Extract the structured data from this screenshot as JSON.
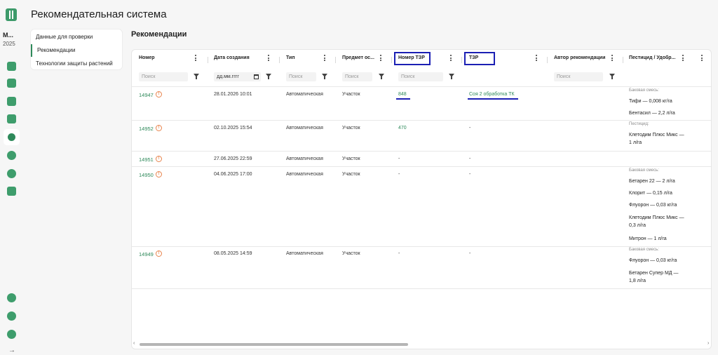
{
  "app": {
    "title": "Рекомендательная система"
  },
  "org": {
    "name": "М...",
    "year": "2025"
  },
  "rail_icons": [
    "fields-icon",
    "layers-icon",
    "machinery-icon",
    "clipboard-icon",
    "protection-icon",
    "settings-wheel-icon",
    "chart-pie-icon",
    "box-icon",
    "gear-icon",
    "help-icon",
    "user-icon"
  ],
  "sidenav": {
    "items": [
      {
        "label": "Данные для проверки"
      },
      {
        "label": "Рекомендации"
      },
      {
        "label": "Технологии защиты растений"
      }
    ]
  },
  "section": {
    "title": "Рекомендации"
  },
  "table": {
    "columns": [
      {
        "label": "Номер"
      },
      {
        "label": "Дата создания"
      },
      {
        "label": "Тип"
      },
      {
        "label": "Предмет ос..."
      },
      {
        "label": "Номер ТЗР"
      },
      {
        "label": "ТЗР"
      },
      {
        "label": "Автор рекомендации"
      },
      {
        "label": "Пестицид / Удобр..."
      }
    ],
    "filters": {
      "search_placeholder": "Поиск",
      "date_placeholder": "дд.мм.гггг"
    },
    "rows": [
      {
        "id": "14947",
        "date": "28.01.2026 10:01",
        "type": "Автоматическая",
        "subject": "Участок",
        "tzr_number": "848",
        "tzr": "Соя 2 обработка ТК",
        "mix_label": "Баковая смесь:",
        "mix": [
          "Тифи — 0,008 кг/га",
          "Бентасил — 2,2 л/га"
        ]
      },
      {
        "id": "14952",
        "date": "02.10.2025 15:54",
        "type": "Автоматическая",
        "subject": "Участок",
        "tzr_number": "470",
        "tzr": "-",
        "mix_label": "Пестицид:",
        "mix": [
          "Клетодим Плюс Микс — 1 л/га"
        ]
      },
      {
        "id": "14951",
        "date": "27.06.2025 22:59",
        "type": "Автоматическая",
        "subject": "Участок",
        "tzr_number": "-",
        "tzr": "-",
        "mix_label": "",
        "mix": []
      },
      {
        "id": "14950",
        "date": "04.06.2025 17:00",
        "type": "Автоматическая",
        "subject": "Участок",
        "tzr_number": "-",
        "tzr": "-",
        "mix_label": "Баковая смесь:",
        "mix": [
          "Бетарен 22 — 2 л/га",
          "Клорит — 0,15 л/га",
          "Флуорон — 0,03 кг/га",
          "Клетодим Плюс Микс — 0,3 л/га",
          "Митрон — 1 л/га"
        ]
      },
      {
        "id": "14949",
        "date": "08.05.2025 14:59",
        "type": "Автоматическая",
        "subject": "Участок",
        "tzr_number": "-",
        "tzr": "-",
        "mix_label": "Баковая смесь:",
        "mix": [
          "Флуорон — 0,03 кг/га",
          "Бетарен Супер МД — 1,8 л/га"
        ]
      }
    ]
  },
  "colors": {
    "accent": "#2f8a5b",
    "warning": "#e8844c",
    "highlight": "#1b1fb4"
  }
}
